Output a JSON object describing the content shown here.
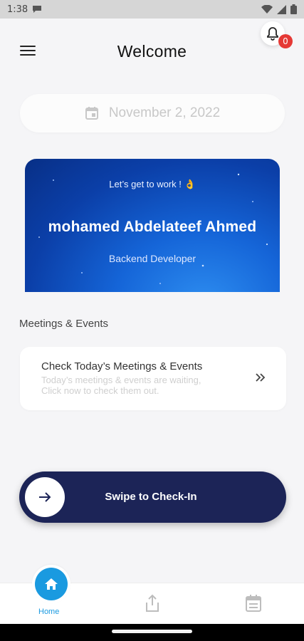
{
  "status_bar": {
    "time": "1:38"
  },
  "header": {
    "title": "Welcome",
    "notification_count": "0"
  },
  "date": {
    "text": "November 2, 2022"
  },
  "welcome_card": {
    "greeting": "Let’s get to work ! 👌",
    "name": "mohamed Abdelateef Ahmed",
    "role": "Backend Developer"
  },
  "meetings": {
    "section_title": "Meetings & Events",
    "card_title": "Check Today’s Meetings & Events",
    "card_subtitle_line1": "Today’s meetings & events are waiting,",
    "card_subtitle_line2": "Click now to check them out."
  },
  "swipe": {
    "label": "Swipe to Check-In"
  },
  "bottom_nav": {
    "home_label": "Home"
  },
  "colors": {
    "accent": "#1a9ae0",
    "swipe_bg": "#1c2457",
    "badge": "#e53935",
    "card_blue": "#1565d8"
  },
  "icons": [
    "chat-icon",
    "wifi-icon",
    "signal-icon",
    "battery-icon",
    "menu-icon",
    "bell-icon",
    "calendar-icon",
    "double-chevron-right-icon",
    "arrow-right-icon",
    "home-icon",
    "share-icon",
    "calendar-list-icon"
  ]
}
